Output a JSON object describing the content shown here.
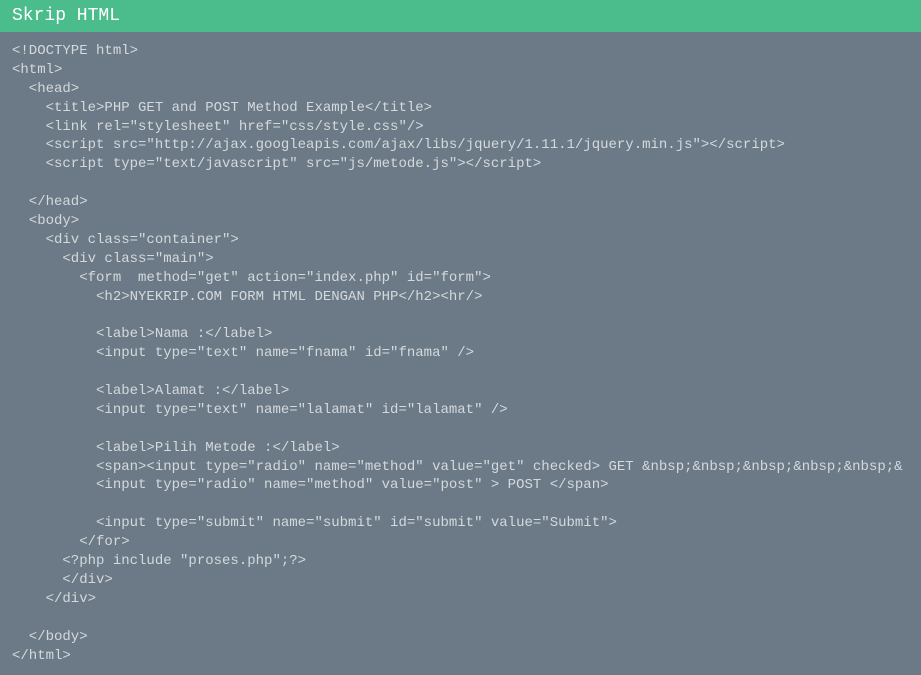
{
  "header": {
    "title": "Skrip HTML"
  },
  "code": {
    "lines": [
      "<!DOCTYPE html>",
      "<html>",
      "  <head>",
      "    <title>PHP GET and POST Method Example</title>",
      "    <link rel=\"stylesheet\" href=\"css/style.css\"/>",
      "    <script src=\"http://ajax.googleapis.com/ajax/libs/jquery/1.11.1/jquery.min.js\"></script>",
      "    <script type=\"text/javascript\" src=\"js/metode.js\"></script>",
      "",
      "  </head>",
      "  <body>",
      "    <div class=\"container\">",
      "      <div class=\"main\">",
      "        <form  method=\"get\" action=\"index.php\" id=\"form\">",
      "          <h2>NYEKRIP.COM FORM HTML DENGAN PHP</h2><hr/>",
      "",
      "          <label>Nama :</label>",
      "          <input type=\"text\" name=\"fnama\" id=\"fnama\" />",
      "",
      "          <label>Alamat :</label>",
      "          <input type=\"text\" name=\"lalamat\" id=\"lalamat\" />",
      "",
      "          <label>Pilih Metode :</label>",
      "          <span><input type=\"radio\" name=\"method\" value=\"get\" checked> GET &nbsp;&nbsp;&nbsp;&nbsp;&nbsp;&",
      "          <input type=\"radio\" name=\"method\" value=\"post\" > POST </span>",
      "",
      "          <input type=\"submit\" name=\"submit\" id=\"submit\" value=\"Submit\">",
      "        </for>",
      "      <?php include \"proses.php\";?>",
      "      </div>",
      "    </div>",
      "",
      "  </body>",
      "</html>"
    ]
  }
}
